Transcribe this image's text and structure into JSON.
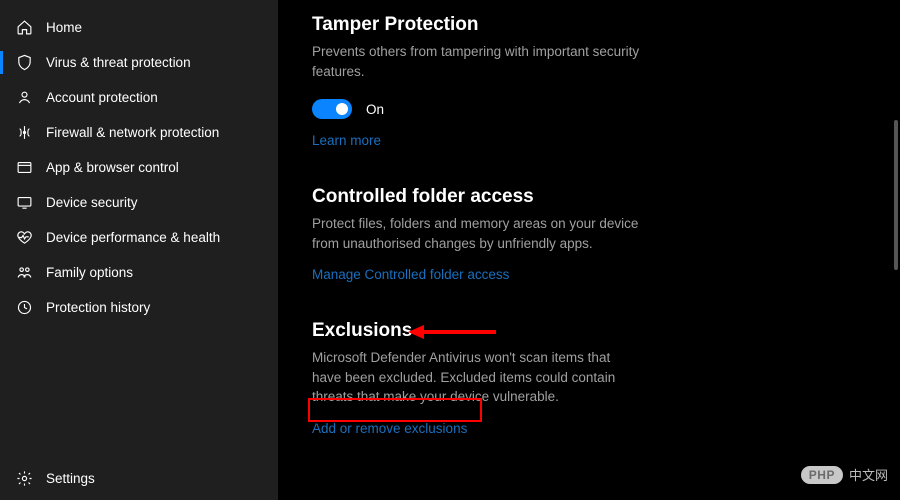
{
  "sidebar": {
    "items": [
      {
        "label": "Home",
        "icon": "home-icon"
      },
      {
        "label": "Virus & threat protection",
        "icon": "shield-icon",
        "active": true
      },
      {
        "label": "Account protection",
        "icon": "account-icon"
      },
      {
        "label": "Firewall & network protection",
        "icon": "network-icon"
      },
      {
        "label": "App & browser control",
        "icon": "browser-icon"
      },
      {
        "label": "Device security",
        "icon": "device-icon"
      },
      {
        "label": "Device performance & health",
        "icon": "heart-icon"
      },
      {
        "label": "Family options",
        "icon": "family-icon"
      },
      {
        "label": "Protection history",
        "icon": "history-icon"
      }
    ],
    "bottom": {
      "label": "Settings",
      "icon": "settings-icon"
    }
  },
  "main": {
    "tamper": {
      "title": "Tamper Protection",
      "desc": "Prevents others from tampering with important security features.",
      "toggle_state": "On",
      "link": "Learn more"
    },
    "controlled": {
      "title": "Controlled folder access",
      "desc": "Protect files, folders and memory areas on your device from unauthorised changes by unfriendly apps.",
      "link": "Manage Controlled folder access"
    },
    "exclusions": {
      "title": "Exclusions",
      "desc": "Microsoft Defender Antivirus won't scan items that have been excluded. Excluded items could contain threats that make your device vulnerable.",
      "link": "Add or remove exclusions"
    }
  },
  "watermark": {
    "pill": "PHP",
    "text": "中文网"
  }
}
